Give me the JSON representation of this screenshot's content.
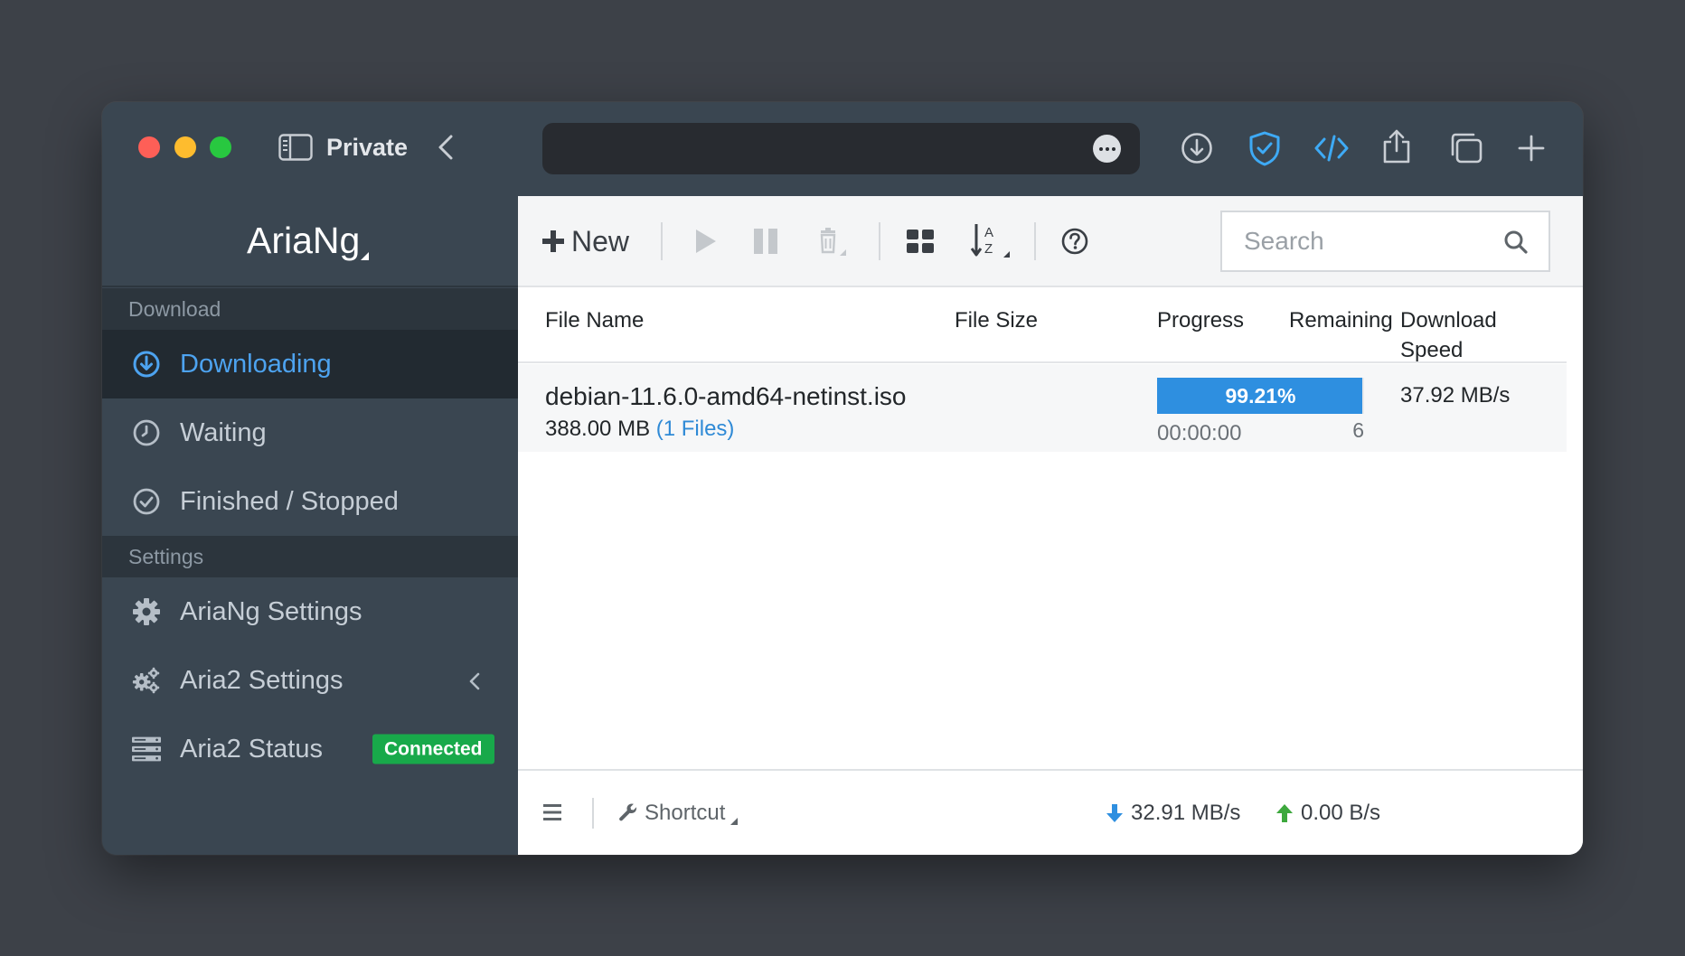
{
  "browser": {
    "private_label": "Private"
  },
  "sidebar": {
    "brand": "AriaNg",
    "sections": [
      {
        "header": "Download"
      },
      {
        "header": "Settings"
      }
    ],
    "download_items": [
      {
        "label": "Downloading",
        "icon": "download-circle-icon",
        "active": true
      },
      {
        "label": "Waiting",
        "icon": "clock-icon",
        "active": false
      },
      {
        "label": "Finished / Stopped",
        "icon": "check-circle-icon",
        "active": false
      }
    ],
    "settings_items": [
      {
        "label": "AriaNg Settings",
        "icon": "gear-icon"
      },
      {
        "label": "Aria2 Settings",
        "icon": "gears-icon"
      },
      {
        "label": "Aria2 Status",
        "icon": "server-icon",
        "badge": "Connected"
      }
    ]
  },
  "toolbar": {
    "new_label": "New",
    "search_placeholder": "Search"
  },
  "table": {
    "columns": [
      "File Name",
      "File Size",
      "Progress",
      "Remaining",
      "Download Speed"
    ],
    "rows": [
      {
        "file_name": "debian-11.6.0-amd64-netinst.iso",
        "size": "388.00 MB",
        "files": "(1 Files)",
        "progress_text": "99.21%",
        "progress": 0.9921,
        "remaining": "00:00:00",
        "connections": "6",
        "speed": "37.92 MB/s"
      }
    ]
  },
  "footer": {
    "shortcut_label": "Shortcut",
    "download_speed": "32.91 MB/s",
    "upload_speed": "0.00 B/s"
  },
  "colors": {
    "accent": "#2e8fe0",
    "connected": "#18a94a",
    "sidebar_bg": "#3a4651",
    "active_text": "#4da3f0"
  }
}
